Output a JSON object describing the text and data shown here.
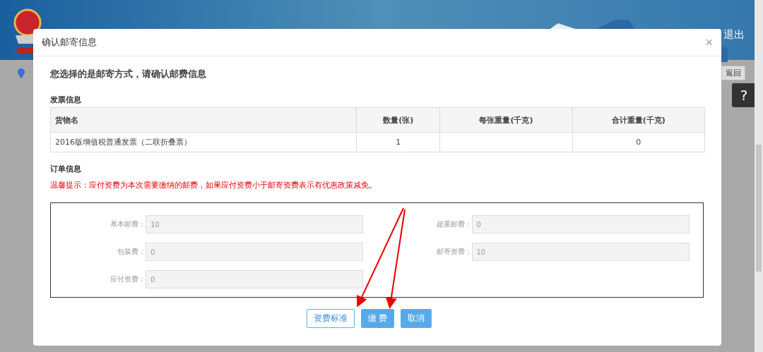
{
  "page": {
    "logout": "退出",
    "back_button": "返回",
    "help_icon": "?"
  },
  "dialog": {
    "title": "确认邮寄信息",
    "close": "×",
    "heading": "您选择的是邮寄方式，请确认邮费信息",
    "invoice_section": "发票信息",
    "table": {
      "columns": [
        "货物名",
        "数量(张)",
        "每张重量(千克)",
        "合计重量(千克)"
      ],
      "rows": [
        [
          "2016版增值税普通发票（二联折叠票）",
          "1",
          "",
          "0"
        ]
      ]
    },
    "order_section": "订单信息",
    "notice": "温馨提示：应付资费为本次需要缴纳的邮费，如果应付资费小于邮寄资费表示有优惠政策减免。",
    "fields": [
      {
        "label": "基本邮费：",
        "value": "10"
      },
      {
        "label": "超重邮费：",
        "value": "0"
      },
      {
        "label": "包装费：",
        "value": "0"
      },
      {
        "label": "邮寄资费：",
        "value": "10"
      },
      {
        "label": "应付资费：",
        "value": "0"
      }
    ],
    "buttons": [
      {
        "label": "资费标准",
        "kind": "outline"
      },
      {
        "label": "缴 费",
        "kind": "primary"
      },
      {
        "label": "取消",
        "kind": "primary"
      }
    ]
  }
}
